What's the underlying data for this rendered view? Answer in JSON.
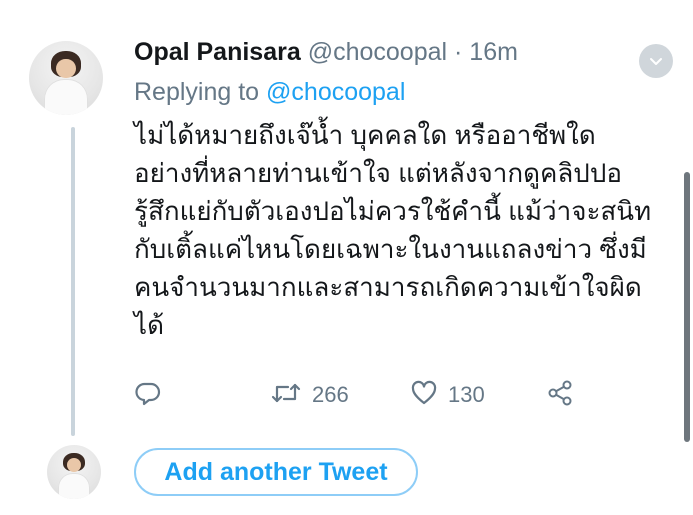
{
  "tweet": {
    "display_name": "Opal Panisara",
    "handle": "@chocoopal",
    "separator": "·",
    "time": "16m",
    "replying_prefix": "Replying to",
    "replying_to": "@chocoopal",
    "text": "ไม่ได้หมายถึงเจ๊น้ำ บุคคลใด หรืออาชีพใด\nอย่างที่หลายท่านเข้าใจ แต่หลังจากดูคลิปปอ\nรู้สึกแย่กับตัวเองปอไม่ควรใช้คำนี้ แม้ว่าจะสนิท\nกับเติ้ลแค่ไหนโดยเฉพาะในงานแถลงข่าว ซึ่งมี\nคนจำนวนมากและสามารถเกิดความเข้าใจผิด\nได้"
  },
  "actions": {
    "reply": {
      "icon": "reply-icon"
    },
    "retweet": {
      "icon": "retweet-icon",
      "count": "266"
    },
    "like": {
      "icon": "heart-icon",
      "count": "130"
    },
    "share": {
      "icon": "share-icon"
    }
  },
  "compose": {
    "add_tweet_label": "Add another Tweet"
  },
  "colors": {
    "accent": "#1da1f2",
    "muted": "#657786",
    "thread_line": "#c9d4dc"
  }
}
